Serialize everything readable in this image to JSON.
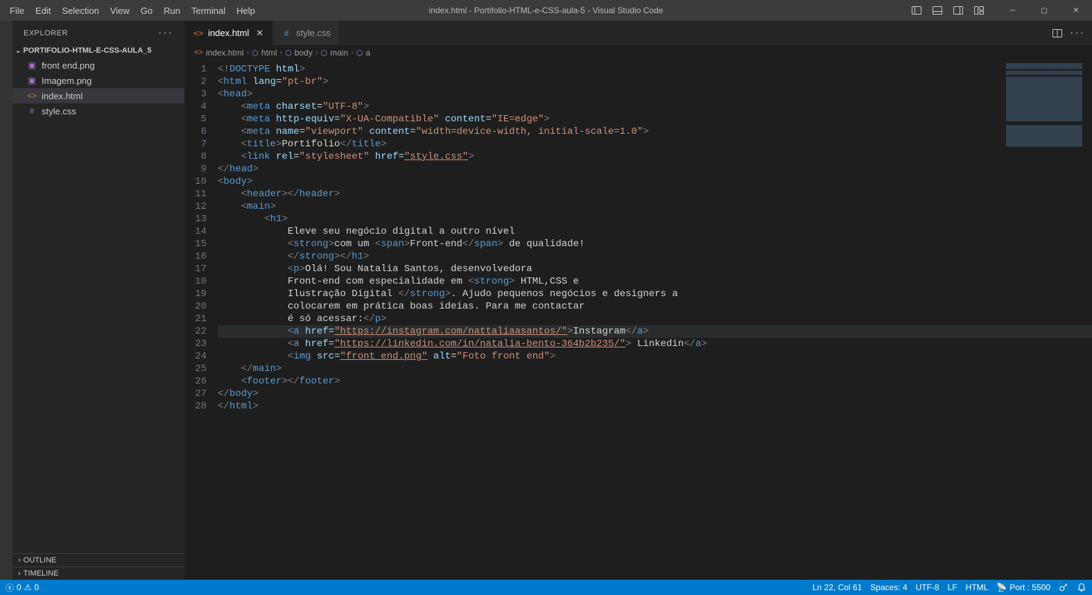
{
  "titlebar": {
    "menus": [
      "File",
      "Edit",
      "Selection",
      "View",
      "Go",
      "Run",
      "Terminal",
      "Help"
    ],
    "title": "index.html - Portifolio-HTML-e-CSS-aula-5 - Visual Studio Code"
  },
  "sidebar": {
    "title": "EXPLORER",
    "project": "PORTIFOLIO-HTML-E-CSS-AULA_5",
    "files": [
      {
        "icon": "img",
        "label": "front end.png"
      },
      {
        "icon": "img",
        "label": "Imagem.png"
      },
      {
        "icon": "html",
        "label": "index.html",
        "selected": true
      },
      {
        "icon": "css",
        "label": "style.css"
      }
    ],
    "outline": "OUTLINE",
    "timeline": "TIMELINE"
  },
  "tabs": [
    {
      "icon": "html",
      "label": "index.html",
      "active": true,
      "close": true
    },
    {
      "icon": "css",
      "label": "style.css",
      "active": false,
      "close": false
    }
  ],
  "breadcrumb": [
    "index.html",
    "html",
    "body",
    "main",
    "a"
  ],
  "code": {
    "lines": 28,
    "content": [
      {
        "n": 1,
        "html": "<span class='tk-gray'>&lt;!</span><span class='tk-blue'>DOCTYPE</span> <span class='tk-lb'>html</span><span class='tk-gray'>&gt;</span>"
      },
      {
        "n": 2,
        "html": "<span class='tk-gray'>&lt;</span><span class='tk-blue'>html</span> <span class='tk-lb'>lang</span><span class='tk-wht'>=</span><span class='tk-str'>\"pt-br\"</span><span class='tk-gray'>&gt;</span>"
      },
      {
        "n": 3,
        "html": "<span class='tk-gray'>&lt;</span><span class='tk-blue'>head</span><span class='tk-gray'>&gt;</span>"
      },
      {
        "n": 4,
        "html": "    <span class='tk-gray'>&lt;</span><span class='tk-blue'>meta</span> <span class='tk-lb'>charset</span><span class='tk-wht'>=</span><span class='tk-str'>\"UTF-8\"</span><span class='tk-gray'>&gt;</span>"
      },
      {
        "n": 5,
        "html": "    <span class='tk-gray'>&lt;</span><span class='tk-blue'>meta</span> <span class='tk-lb'>http-equiv</span><span class='tk-wht'>=</span><span class='tk-str'>\"X-UA-Compatible\"</span> <span class='tk-lb'>content</span><span class='tk-wht'>=</span><span class='tk-str'>\"IE=edge\"</span><span class='tk-gray'>&gt;</span>"
      },
      {
        "n": 6,
        "html": "    <span class='tk-gray'>&lt;</span><span class='tk-blue'>meta</span> <span class='tk-lb'>name</span><span class='tk-wht'>=</span><span class='tk-str'>\"viewport\"</span> <span class='tk-lb'>content</span><span class='tk-wht'>=</span><span class='tk-str'>\"width=device-width, initial-scale=1.0\"</span><span class='tk-gray'>&gt;</span>"
      },
      {
        "n": 7,
        "html": "    <span class='tk-gray'>&lt;</span><span class='tk-blue'>title</span><span class='tk-gray'>&gt;</span><span class='tk-wht'>Portifolio</span><span class='tk-gray'>&lt;/</span><span class='tk-blue'>title</span><span class='tk-gray'>&gt;</span>"
      },
      {
        "n": 8,
        "html": "    <span class='tk-gray'>&lt;</span><span class='tk-blue'>link</span> <span class='tk-lb'>rel</span><span class='tk-wht'>=</span><span class='tk-str'>\"stylesheet\"</span> <span class='tk-lb'>href</span><span class='tk-wht'>=</span><span class='tk-str tk-ul'>\"style.css\"</span><span class='tk-gray'>&gt;</span>"
      },
      {
        "n": 9,
        "html": "<span class='tk-gray'>&lt;/</span><span class='tk-blue'>head</span><span class='tk-gray'>&gt;</span>"
      },
      {
        "n": 10,
        "html": "<span class='tk-gray'>&lt;</span><span class='tk-blue'>body</span><span class='tk-gray'>&gt;</span>"
      },
      {
        "n": 11,
        "html": "    <span class='tk-gray'>&lt;</span><span class='tk-blue'>header</span><span class='tk-gray'>&gt;&lt;/</span><span class='tk-blue'>header</span><span class='tk-gray'>&gt;</span>"
      },
      {
        "n": 12,
        "html": "    <span class='tk-gray'>&lt;</span><span class='tk-blue'>main</span><span class='tk-gray'>&gt;</span>"
      },
      {
        "n": 13,
        "html": "        <span class='tk-gray'>&lt;</span><span class='tk-blue'>h1</span><span class='tk-gray'>&gt;</span>"
      },
      {
        "n": 14,
        "html": "            <span class='tk-wht'>Eleve seu negócio digital a outro nível</span>"
      },
      {
        "n": 15,
        "html": "            <span class='tk-gray'>&lt;</span><span class='tk-blue'>strong</span><span class='tk-gray'>&gt;</span><span class='tk-wht'>com um </span><span class='tk-gray'>&lt;</span><span class='tk-blue'>span</span><span class='tk-gray'>&gt;</span><span class='tk-wht'>Front-end</span><span class='tk-gray'>&lt;/</span><span class='tk-blue'>span</span><span class='tk-gray'>&gt;</span><span class='tk-wht'> de qualidade!</span>"
      },
      {
        "n": 16,
        "html": "            <span class='tk-gray'>&lt;/</span><span class='tk-blue'>strong</span><span class='tk-gray'>&gt;&lt;/</span><span class='tk-blue'>h1</span><span class='tk-gray'>&gt;</span>"
      },
      {
        "n": 17,
        "html": "            <span class='tk-gray'>&lt;</span><span class='tk-blue'>p</span><span class='tk-gray'>&gt;</span><span class='tk-wht'>Olá! Sou Natalia Santos, desenvolvedora</span>"
      },
      {
        "n": 18,
        "html": "            <span class='tk-wht'>Front-end com especialidade em </span><span class='tk-gray'>&lt;</span><span class='tk-blue'>strong</span><span class='tk-gray'>&gt;</span><span class='tk-wht'> HTML,CSS e</span>"
      },
      {
        "n": 19,
        "html": "            <span class='tk-wht'>Ilustração Digital </span><span class='tk-gray'>&lt;/</span><span class='tk-blue'>strong</span><span class='tk-gray'>&gt;</span><span class='tk-wht'>. Ajudo pequenos negócios e designers a</span>"
      },
      {
        "n": 20,
        "html": "            <span class='tk-wht'>colocarem em prática boas ideias. Para me contactar</span>"
      },
      {
        "n": 21,
        "html": "            <span class='tk-wht'>é só acessar:</span><span class='tk-gray'>&lt;/</span><span class='tk-blue'>p</span><span class='tk-gray'>&gt;</span>"
      },
      {
        "n": 22,
        "hl": true,
        "html": "            <span class='tk-gray'>&lt;</span><span class='tk-blue'>a</span> <span class='tk-lb'>href</span><span class='tk-wht'>=</span><span class='tk-str tk-ul'>\"https://instagram.com/nattaliaasantos/\"</span><span class='tk-gray'>&gt;</span><span class='tk-wht'>Instagram</span><span class='tk-gray'>&lt;/</span><span class='tk-blue'>a</span><span class='tk-gray'>&gt;</span>"
      },
      {
        "n": 23,
        "html": "            <span class='tk-gray'>&lt;</span><span class='tk-blue'>a</span> <span class='tk-lb'>href</span><span class='tk-wht'>=</span><span class='tk-str tk-ul'>\"https://linkedin.com/in/natalia-bento-364b2b235/\"</span><span class='tk-gray'>&gt;</span><span class='tk-wht'> Linkedin</span><span class='tk-gray'>&lt;/</span><span class='tk-blue'>a</span><span class='tk-gray'>&gt;</span>"
      },
      {
        "n": 24,
        "html": "            <span class='tk-gray'>&lt;</span><span class='tk-blue'>img</span> <span class='tk-lb'>src</span><span class='tk-wht'>=</span><span class='tk-str tk-ul'>\"front_end.png\"</span> <span class='tk-lb'>alt</span><span class='tk-wht'>=</span><span class='tk-str'>\"Foto front end\"</span><span class='tk-gray'>&gt;</span>"
      },
      {
        "n": 25,
        "html": "    <span class='tk-gray'>&lt;/</span><span class='tk-blue'>main</span><span class='tk-gray'>&gt;</span>"
      },
      {
        "n": 26,
        "html": "    <span class='tk-gray'>&lt;</span><span class='tk-blue'>footer</span><span class='tk-gray'>&gt;&lt;/</span><span class='tk-blue'>footer</span><span class='tk-gray'>&gt;</span>"
      },
      {
        "n": 27,
        "html": "<span class='tk-gray'>&lt;/</span><span class='tk-blue'>body</span><span class='tk-gray'>&gt;</span>"
      },
      {
        "n": 28,
        "html": "<span class='tk-gray'>&lt;/</span><span class='tk-blue'>html</span><span class='tk-gray'>&gt;</span>"
      }
    ]
  },
  "status": {
    "left_errors": "0",
    "left_warnings": "0",
    "cursor": "Ln 22, Col 61",
    "spaces": "Spaces: 4",
    "encoding": "UTF-8",
    "eol": "LF",
    "lang": "HTML",
    "port": "Port : 5500"
  }
}
